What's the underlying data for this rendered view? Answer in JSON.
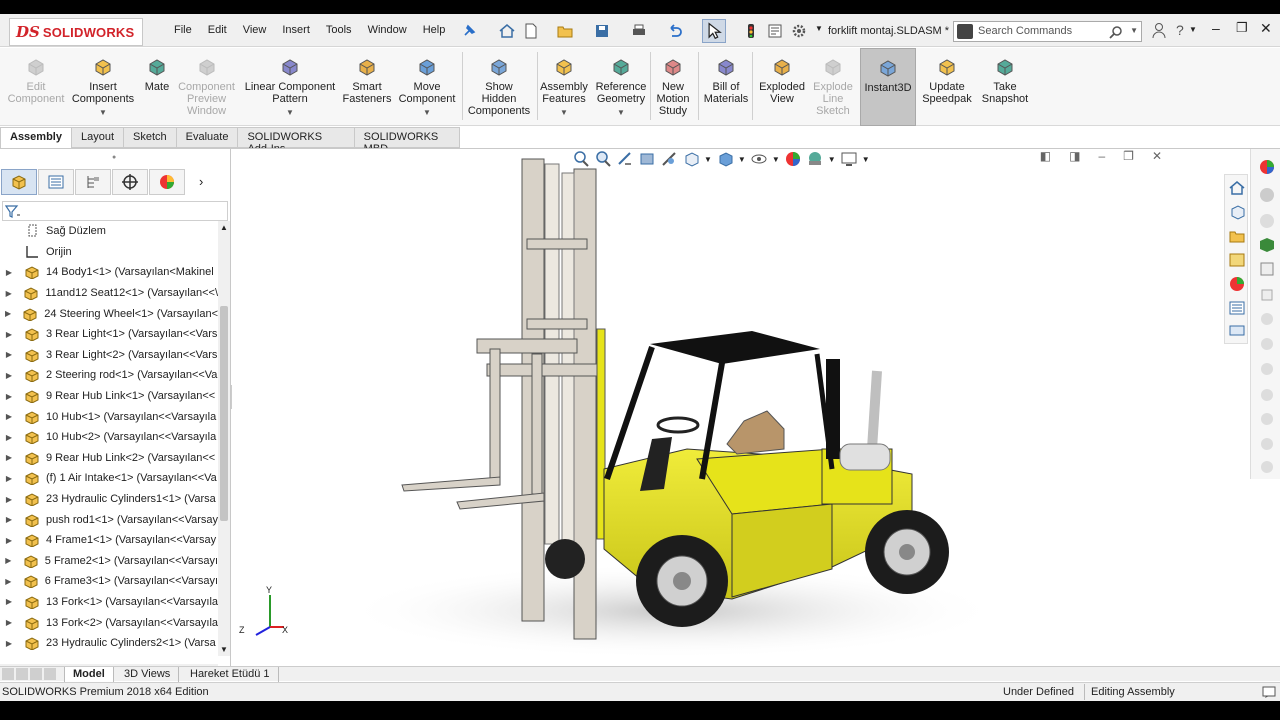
{
  "app": {
    "brand": "SOLIDWORKS",
    "document_title": "forklift montaj.SLDASM *"
  },
  "menu": [
    "File",
    "Edit",
    "View",
    "Insert",
    "Tools",
    "Window",
    "Help"
  ],
  "search": {
    "placeholder": "Search Commands"
  },
  "ribbon": [
    {
      "label": "Edit\nComponent",
      "icon": "edit-component-icon",
      "disabled": true
    },
    {
      "label": "Insert\nComponents",
      "icon": "insert-components-icon",
      "dropdown": true
    },
    {
      "label": "Mate",
      "icon": "mate-icon"
    },
    {
      "label": "Component\nPreview\nWindow",
      "icon": "component-preview-icon",
      "disabled": true
    },
    {
      "label": "Linear Component\nPattern",
      "icon": "linear-pattern-icon",
      "dropdown": true
    },
    {
      "label": "Smart\nFasteners",
      "icon": "smart-fasteners-icon"
    },
    {
      "label": "Move\nComponent",
      "icon": "move-component-icon",
      "dropdown": true
    },
    {
      "label": "Show\nHidden\nComponents",
      "icon": "show-hidden-icon"
    },
    {
      "label": "Assembly\nFeatures",
      "icon": "assembly-features-icon",
      "dropdown": true
    },
    {
      "label": "Reference\nGeometry",
      "icon": "reference-geometry-icon",
      "dropdown": true
    },
    {
      "label": "New\nMotion\nStudy",
      "icon": "motion-study-icon"
    },
    {
      "label": "Bill of\nMaterials",
      "icon": "bom-icon"
    },
    {
      "label": "Exploded\nView",
      "icon": "exploded-view-icon"
    },
    {
      "label": "Explode\nLine\nSketch",
      "icon": "explode-line-icon",
      "disabled": true
    },
    {
      "label": "Instant3D",
      "icon": "instant3d-icon",
      "active": true
    },
    {
      "label": "Update\nSpeedpak",
      "icon": "speedpak-icon"
    },
    {
      "label": "Take\nSnapshot",
      "icon": "snapshot-icon"
    }
  ],
  "command_tabs": [
    "Assembly",
    "Layout",
    "Sketch",
    "Evaluate",
    "SOLIDWORKS Add-Ins",
    "SOLIDWORKS MBD"
  ],
  "tree": [
    {
      "label": "Sağ Düzlem",
      "type": "plane",
      "expand": false
    },
    {
      "label": "Orijin",
      "type": "origin",
      "expand": false
    },
    {
      "label": "14 Body1<1> (Varsayılan<Makinel",
      "type": "part",
      "expand": true
    },
    {
      "label": "11and12 Seat12<1> (Varsayılan<<\\",
      "type": "part",
      "expand": true
    },
    {
      "label": "24 Steering Wheel<1> (Varsayılan<",
      "type": "part",
      "expand": true
    },
    {
      "label": "3 Rear Light<1> (Varsayılan<<Vars",
      "type": "part",
      "expand": true
    },
    {
      "label": "3 Rear Light<2> (Varsayılan<<Vars",
      "type": "part",
      "expand": true
    },
    {
      "label": "2 Steering rod<1> (Varsayılan<<Va",
      "type": "part",
      "expand": true
    },
    {
      "label": "9 Rear Hub Link<1> (Varsayılan<<",
      "type": "part",
      "expand": true
    },
    {
      "label": "10 Hub<1> (Varsayılan<<Varsayıla",
      "type": "part",
      "expand": true
    },
    {
      "label": "10 Hub<2> (Varsayılan<<Varsayıla",
      "type": "part",
      "expand": true
    },
    {
      "label": "9 Rear Hub Link<2> (Varsayılan<<",
      "type": "part",
      "expand": true
    },
    {
      "label": "(f) 1 Air Intake<1> (Varsayılan<<Va",
      "type": "part",
      "expand": true
    },
    {
      "label": "23 Hydraulic Cylinders1<1> (Varsa",
      "type": "part",
      "expand": true
    },
    {
      "label": "push rod1<1> (Varsayılan<<Varsay",
      "type": "part",
      "expand": true
    },
    {
      "label": "4 Frame1<1> (Varsayılan<<Varsay",
      "type": "part",
      "expand": true
    },
    {
      "label": "5 Frame2<1> (Varsayılan<<Varsayı",
      "type": "part",
      "expand": true
    },
    {
      "label": "6 Frame3<1> (Varsayılan<<Varsayı",
      "type": "part",
      "expand": true
    },
    {
      "label": "13 Fork<1> (Varsayılan<<Varsayıla",
      "type": "part",
      "expand": true
    },
    {
      "label": "13 Fork<2> (Varsayılan<<Varsayıla",
      "type": "part",
      "expand": true
    },
    {
      "label": "23 Hydraulic Cylinders2<1> (Varsa",
      "type": "part",
      "expand": true
    }
  ],
  "bottom_tabs": [
    "Model",
    "3D Views",
    "Hareket Etüdü 1"
  ],
  "status": {
    "edition": "SOLIDWORKS Premium 2018 x64 Edition",
    "definition": "Under Defined",
    "mode": "Editing Assembly"
  },
  "colors": {
    "brand_red": "#d2232a",
    "forklift_yellow": "#e6e31a",
    "mast_grey": "#d8d2c8"
  }
}
